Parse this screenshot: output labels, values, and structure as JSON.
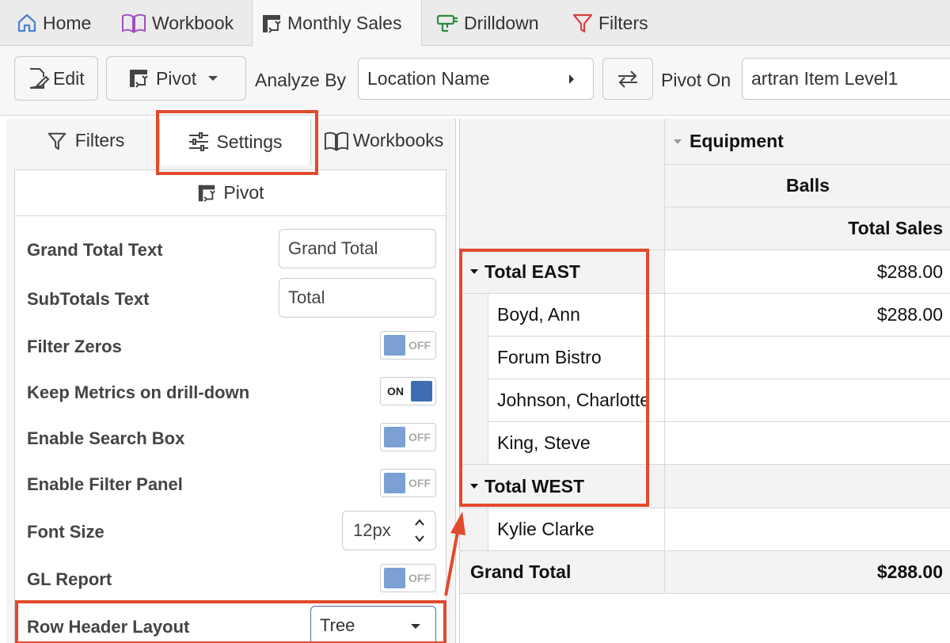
{
  "tabs": [
    {
      "label": "Home",
      "icon": "home-icon"
    },
    {
      "label": "Workbook",
      "icon": "book-icon"
    },
    {
      "label": "Monthly Sales",
      "icon": "pivot-icon",
      "active": true
    },
    {
      "label": "Drilldown",
      "icon": "drilldown-icon"
    },
    {
      "label": "Filters",
      "icon": "filter-icon"
    }
  ],
  "toolbar": {
    "edit_label": "Edit",
    "pivot_label": "Pivot",
    "analyze_by_label": "Analyze By",
    "analyze_by_value": "Location Name",
    "pivot_on_label": "Pivot On",
    "pivot_on_value": "artran Item Level1"
  },
  "panel": {
    "tabs": [
      {
        "label": "Filters",
        "icon": "filter-icon"
      },
      {
        "label": "Settings",
        "icon": "sliders-icon",
        "active": true
      },
      {
        "label": "Workbooks",
        "icon": "book-icon"
      }
    ],
    "section_title": "Pivot",
    "settings": {
      "grand_total_text": {
        "label": "Grand Total Text",
        "value": "Grand Total"
      },
      "subtotals_text": {
        "label": "SubTotals Text",
        "value": "Total"
      },
      "filter_zeros": {
        "label": "Filter Zeros",
        "state": "OFF"
      },
      "keep_metrics": {
        "label": "Keep Metrics on drill-down",
        "state": "ON"
      },
      "enable_search": {
        "label": "Enable Search Box",
        "state": "OFF"
      },
      "enable_filter_panel": {
        "label": "Enable Filter Panel",
        "state": "OFF"
      },
      "font_size": {
        "label": "Font Size",
        "value": "12px"
      },
      "gl_report": {
        "label": "GL Report",
        "state": "OFF"
      },
      "row_header_layout": {
        "label": "Row Header Layout",
        "value": "Tree"
      }
    }
  },
  "grid": {
    "col_header_1": "Equipment",
    "col_header_2": "Balls",
    "col_header_3": "Total Sales",
    "rows": [
      {
        "label": "Total EAST",
        "value": "$288.00",
        "type": "group"
      },
      {
        "label": "Boyd, Ann",
        "value": "$288.00",
        "type": "child"
      },
      {
        "label": "Forum Bistro",
        "value": "",
        "type": "child"
      },
      {
        "label": "Johnson, Charlotte",
        "value": "",
        "type": "child"
      },
      {
        "label": "King, Steve",
        "value": "",
        "type": "child"
      },
      {
        "label": "Total WEST",
        "value": "",
        "type": "group"
      },
      {
        "label": "Kylie Clarke",
        "value": "",
        "type": "child"
      }
    ],
    "grand_total_label": "Grand Total",
    "grand_total_value": "$288.00"
  },
  "colors": {
    "annotation": "#e24a2c",
    "toggle_on": "#3d6eb1",
    "toggle_off": "#7aa0d4"
  }
}
